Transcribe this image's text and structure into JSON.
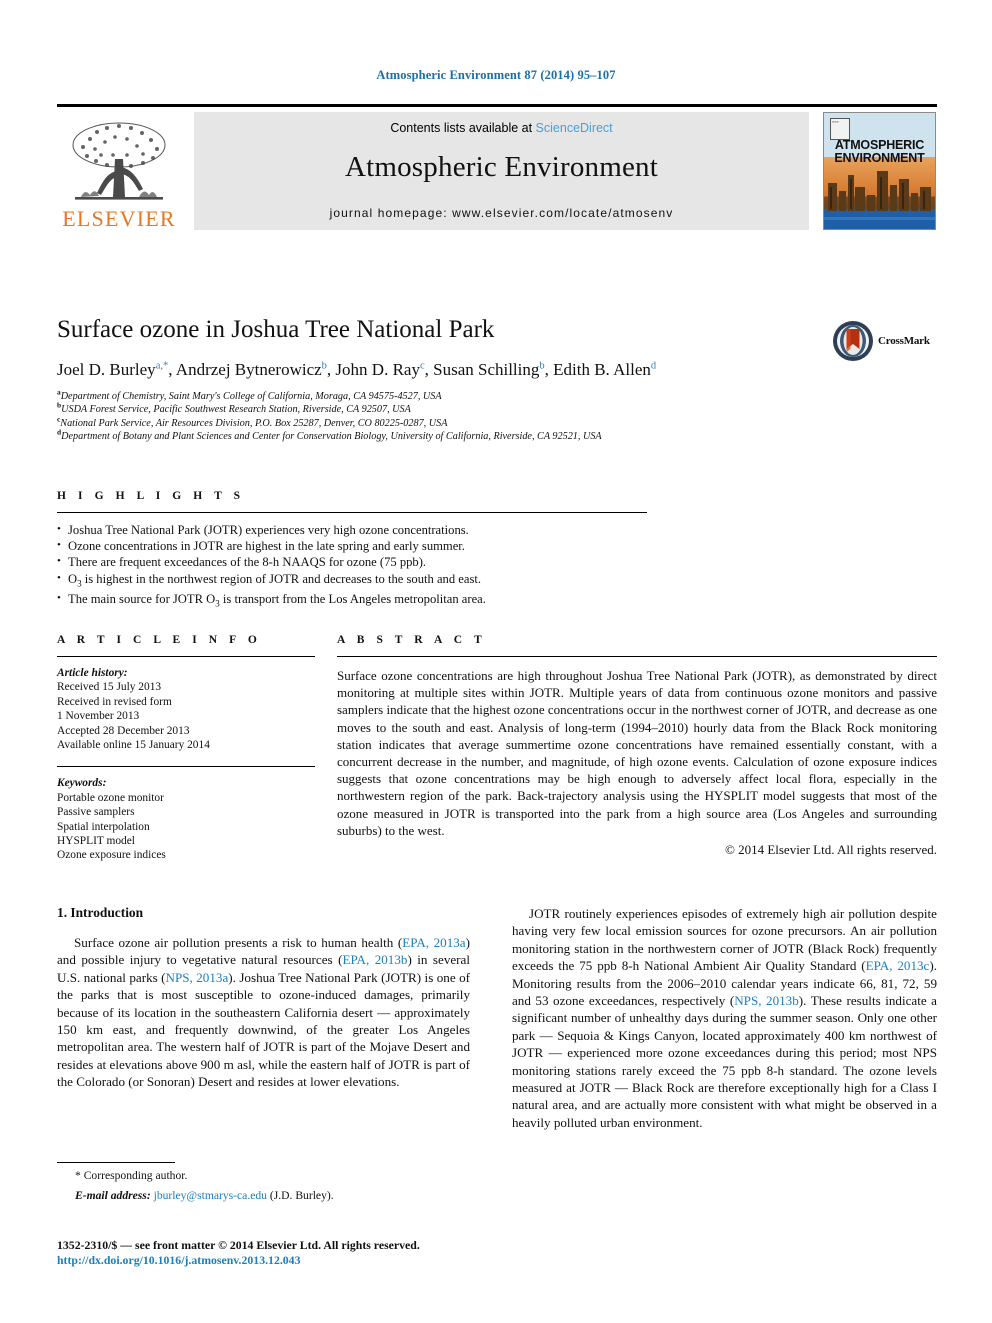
{
  "running_head": "Atmospheric Environment 87 (2014) 95–107",
  "masthead": {
    "contents_prefix": "Contents lists available at ",
    "sciencedirect": "ScienceDirect",
    "journal_title": "Atmospheric Environment",
    "homepage": "journal homepage: www.elsevier.com/locate/atmosenv",
    "publisher_name": "ELSEVIER",
    "cover_title_line1": "ATMOSPHERIC",
    "cover_title_line2": "ENVIRONMENT",
    "accent_blue": "#4a9fd5",
    "elsevier_orange": "#E87722"
  },
  "crossmark": {
    "label": "CrossMark"
  },
  "article": {
    "title": "Surface ozone in Joshua Tree National Park",
    "authors": [
      {
        "name": "Joel D. Burley",
        "marks": "a,*"
      },
      {
        "name": "Andrzej Bytnerowicz",
        "marks": "b"
      },
      {
        "name": "John D. Ray",
        "marks": "c"
      },
      {
        "name": "Susan Schilling",
        "marks": "b"
      },
      {
        "name": "Edith B. Allen",
        "marks": "d"
      }
    ],
    "affiliations": [
      {
        "mark": "a",
        "text": "Department of Chemistry, Saint Mary's College of California, Moraga, CA 94575-4527, USA"
      },
      {
        "mark": "b",
        "text": "USDA Forest Service, Pacific Southwest Research Station, Riverside, CA 92507, USA"
      },
      {
        "mark": "c",
        "text": "National Park Service, Air Resources Division, P.O. Box 25287, Denver, CO 80225-0287, USA"
      },
      {
        "mark": "d",
        "text": "Department of Botany and Plant Sciences and Center for Conservation Biology, University of California, Riverside, CA 92521, USA"
      }
    ]
  },
  "highlights": {
    "heading": "H I G H L I G H T S",
    "items": [
      "Joshua Tree National Park (JOTR) experiences very high ozone concentrations.",
      "Ozone concentrations in JOTR are highest in the late spring and early summer.",
      "There are frequent exceedances of the 8-h NAAQS for ozone (75 ppb).",
      "O3 is highest in the northwest region of JOTR and decreases to the south and east.",
      "The main source for JOTR O3 is transport from the Los Angeles metropolitan area."
    ]
  },
  "article_info": {
    "heading": "A R T I C L E   I N F O",
    "history_label": "Article history:",
    "history": [
      "Received 15 July 2013",
      "Received in revised form",
      "1 November 2013",
      "Accepted 28 December 2013",
      "Available online 15 January 2014"
    ],
    "keywords_label": "Keywords:",
    "keywords": [
      "Portable ozone monitor",
      "Passive samplers",
      "Spatial interpolation",
      "HYSPLIT model",
      "Ozone exposure indices"
    ]
  },
  "abstract": {
    "heading": "A B S T R A C T",
    "text": "Surface ozone concentrations are high throughout Joshua Tree National Park (JOTR), as demonstrated by direct monitoring at multiple sites within JOTR. Multiple years of data from continuous ozone monitors and passive samplers indicate that the highest ozone concentrations occur in the northwest corner of JOTR, and decrease as one moves to the south and east. Analysis of long-term (1994–2010) hourly data from the Black Rock monitoring station indicates that average summertime ozone concentrations have remained essentially constant, with a concurrent decrease in the number, and magnitude, of high ozone events. Calculation of ozone exposure indices suggests that ozone concentrations may be high enough to adversely affect local flora, especially in the northwestern region of the park. Back-trajectory analysis using the HYSPLIT model suggests that most of the ozone measured in JOTR is transported into the park from a high source area (Los Angeles and surrounding suburbs) to the west.",
    "copyright": "© 2014 Elsevier Ltd. All rights reserved."
  },
  "body": {
    "section_heading": "1.  Introduction",
    "left_paragraph_parts": [
      "Surface ozone air pollution presents a risk to human health (",
      "EPA, 2013a",
      ") and possible injury to vegetative natural resources (",
      "EPA, 2013b",
      ") in several U.S. national parks (",
      "NPS, 2013a",
      "). Joshua Tree National Park (JOTR) is one of the parks that is most susceptible to ozone-induced damages, primarily because of its location in the southeastern California desert — approximately 150 km east, and frequently downwind, of the greater Los Angeles metropolitan area. The western half of JOTR is part of the Mojave Desert and resides at elevations above 900 m asl, while the eastern half of JOTR is part of the Colorado (or Sonoran) Desert and resides at lower elevations."
    ],
    "right_paragraph_parts": [
      "JOTR routinely experiences episodes of extremely high air pollution despite having very few local emission sources for ozone precursors. An air pollution monitoring station in the northwestern corner of JOTR (Black Rock) frequently exceeds the 75 ppb 8-h National Ambient Air Quality Standard (",
      "EPA, 2013c",
      "). Monitoring results from the 2006–2010 calendar years indicate 66, 81, 72, 59 and 53 ozone exceedances, respectively (",
      "NPS, 2013b",
      "). These results indicate a significant number of unhealthy days during the summer season. Only one other park — Sequoia & Kings Canyon, located approximately 400 km northwest of JOTR — experienced more ozone exceedances during this period; most NPS monitoring stations rarely exceed the 75 ppb 8-h standard. The ozone levels measured at JOTR — Black Rock are therefore exceptionally high for a Class I natural area, and are actually more consistent with what might be observed in a heavily polluted urban environment."
    ]
  },
  "footnote": {
    "corresponding": "* Corresponding author.",
    "email_label": "E-mail address:",
    "email": "jburley@stmarys-ca.edu",
    "email_owner": "(J.D. Burley)."
  },
  "footer": {
    "issn_line": "1352-2310/$ — see front matter © 2014 Elsevier Ltd. All rights reserved.",
    "doi": "http://dx.doi.org/10.1016/j.atmosenv.2013.12.043"
  }
}
